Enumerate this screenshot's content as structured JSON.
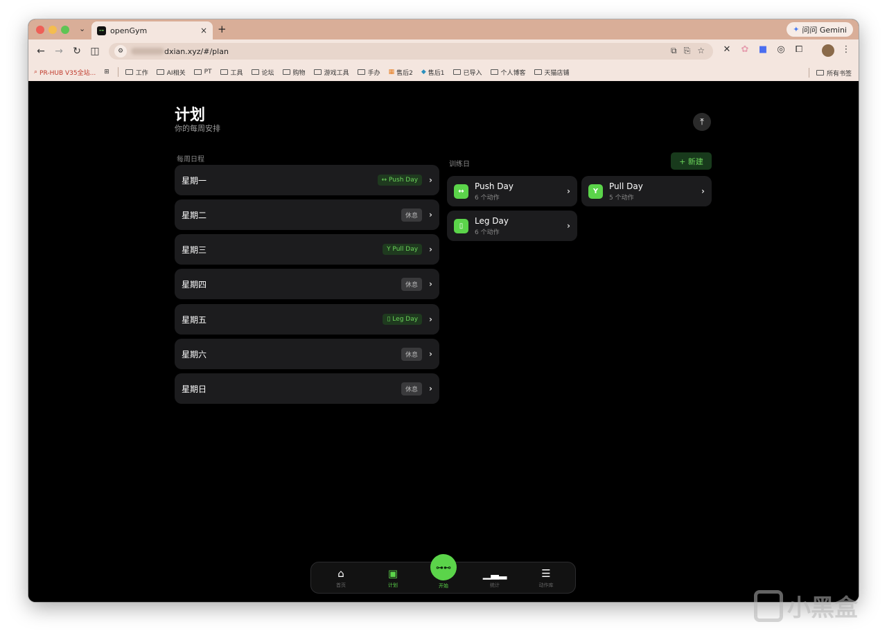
{
  "browser": {
    "tab_title": "openGym",
    "tab_favicon": "dumbbell",
    "gemini_label": "问问 Gemini",
    "url": "dxian.xyz/#/plan",
    "bookmarks": [
      {
        "label": "PR-HUB V35全站...",
        "type": "link"
      },
      {
        "label": "工作",
        "type": "folder"
      },
      {
        "label": "AI相关",
        "type": "folder"
      },
      {
        "label": "PT",
        "type": "folder"
      },
      {
        "label": "工具",
        "type": "folder"
      },
      {
        "label": "论坛",
        "type": "folder"
      },
      {
        "label": "购物",
        "type": "folder"
      },
      {
        "label": "游戏工具",
        "type": "folder"
      },
      {
        "label": "手办",
        "type": "folder"
      },
      {
        "label": "售后2",
        "type": "link"
      },
      {
        "label": "售后1",
        "type": "link"
      },
      {
        "label": "已导入",
        "type": "folder"
      },
      {
        "label": "个人博客",
        "type": "folder"
      },
      {
        "label": "天猫店铺",
        "type": "folder"
      }
    ],
    "all_bookmarks": "所有书签"
  },
  "page": {
    "title": "计划",
    "subtitle": "你的每周安排",
    "weekly_label": "每周日程",
    "training_label": "训练日",
    "new_button": "+ 新建"
  },
  "schedule": [
    {
      "day": "星期一",
      "badge": "↔ Push Day",
      "type": "workout"
    },
    {
      "day": "星期二",
      "badge": "休息",
      "type": "rest"
    },
    {
      "day": "星期三",
      "badge": "Y Pull Day",
      "type": "workout"
    },
    {
      "day": "星期四",
      "badge": "休息",
      "type": "rest"
    },
    {
      "day": "星期五",
      "badge": "▯ Leg Day",
      "type": "workout"
    },
    {
      "day": "星期六",
      "badge": "休息",
      "type": "rest"
    },
    {
      "day": "星期日",
      "badge": "休息",
      "type": "rest"
    }
  ],
  "training_days": [
    {
      "name": "Push Day",
      "count": "6 个动作",
      "icon": "↔"
    },
    {
      "name": "Pull Day",
      "count": "5 个动作",
      "icon": "Y"
    },
    {
      "name": "Leg Day",
      "count": "6 个动作",
      "icon": "▯"
    }
  ],
  "nav": {
    "home": "首页",
    "plan": "计划",
    "start": "开始",
    "stats": "统计",
    "library": "动作库"
  },
  "watermark": "小黑盒",
  "colors": {
    "accent": "#5bd44a",
    "card": "#1c1c1e",
    "background": "#000000"
  }
}
